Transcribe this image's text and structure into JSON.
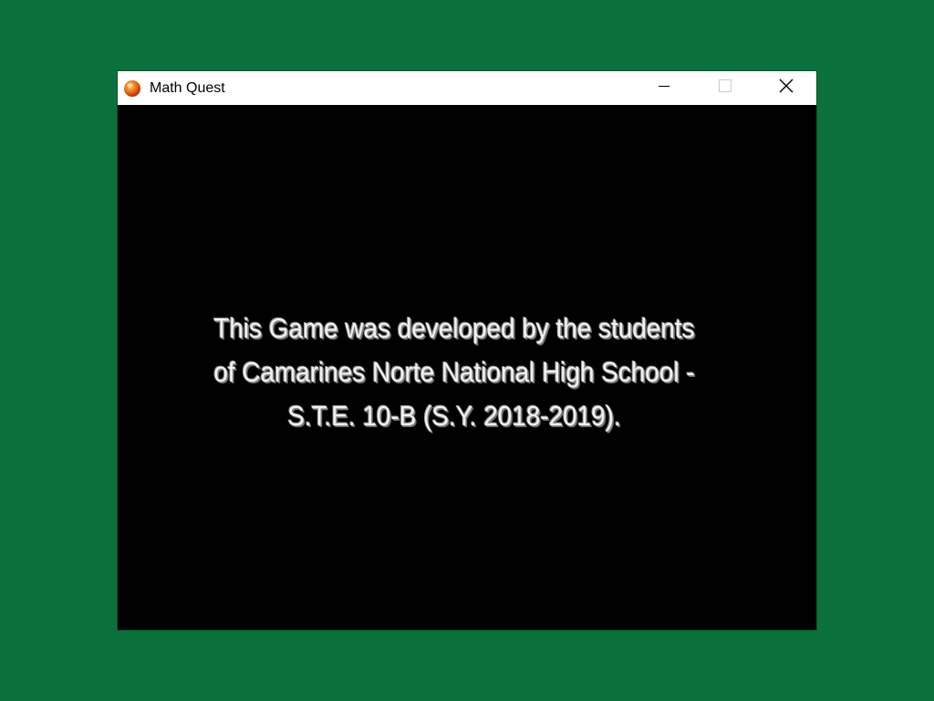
{
  "window": {
    "title": "Math Quest",
    "app_icon": "orange-ball-icon",
    "controls": {
      "minimize_icon": "minimize-icon",
      "maximize_icon": "maximize-icon",
      "close_icon": "close-icon"
    }
  },
  "content": {
    "message_lines": [
      "This Game was developed by the students",
      "of Camarines Norte National High School -",
      "S.T.E. 10-B (S.Y. 2018-2019)."
    ]
  },
  "colors": {
    "desktop_background": "#0a713c",
    "window_background": "#000000",
    "titlebar_background": "#ffffff",
    "message_text": "#f1f1f1"
  }
}
